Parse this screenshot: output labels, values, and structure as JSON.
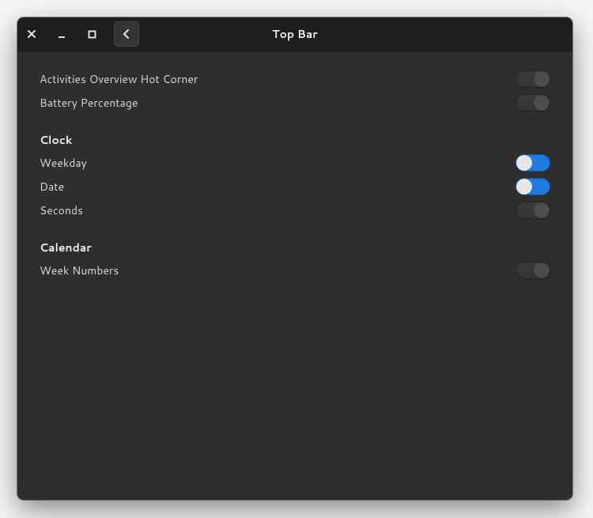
{
  "window": {
    "title": "Top Bar"
  },
  "sections": [
    {
      "heading": null,
      "rows": [
        {
          "key": "hot-corner",
          "label": "Activities Overview Hot Corner",
          "enabled": false
        },
        {
          "key": "battery-percentage",
          "label": "Battery Percentage",
          "enabled": false
        }
      ]
    },
    {
      "heading": "Clock",
      "rows": [
        {
          "key": "weekday",
          "label": "Weekday",
          "enabled": true
        },
        {
          "key": "date",
          "label": "Date",
          "enabled": true
        },
        {
          "key": "seconds",
          "label": "Seconds",
          "enabled": false
        }
      ]
    },
    {
      "heading": "Calendar",
      "rows": [
        {
          "key": "week-numbers",
          "label": "Week Numbers",
          "enabled": false
        }
      ]
    }
  ]
}
